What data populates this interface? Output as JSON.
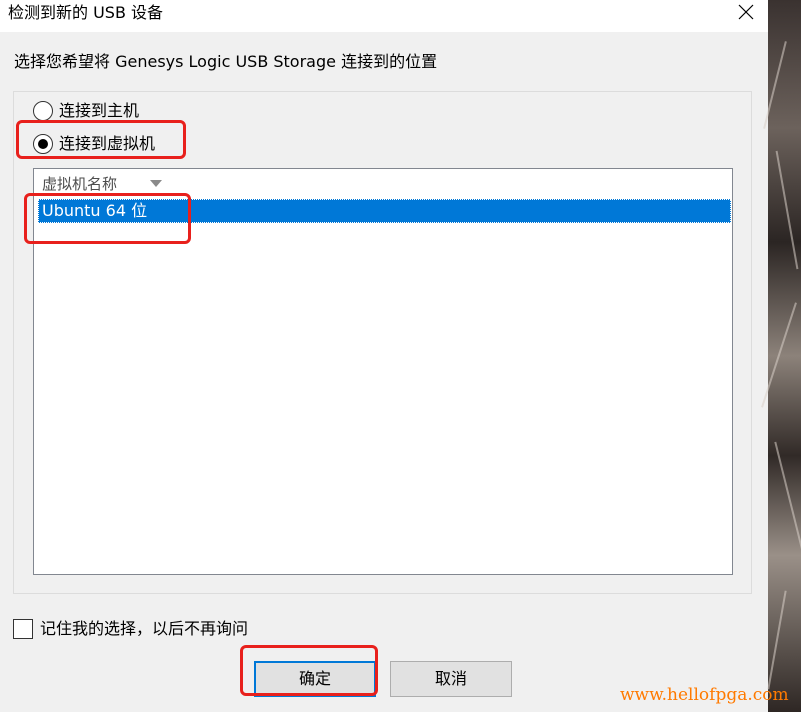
{
  "dialog": {
    "title": "检测到新的 USB 设备",
    "prompt": "选择您希望将 Genesys Logic USB Storage 连接到的位置",
    "options": [
      {
        "label": "连接到主机",
        "selected": false
      },
      {
        "label": "连接到虚拟机",
        "selected": true
      }
    ],
    "list": {
      "column_header": "虚拟机名称",
      "rows": [
        "Ubuntu 64 位"
      ],
      "selected_index": 0
    },
    "remember_label": "记住我的选择，以后不再询问",
    "remember_checked": false,
    "ok_label": "确定",
    "cancel_label": "取消"
  },
  "watermark": "www.hellofpga.com",
  "colors": {
    "highlight": "#e8201c",
    "selection": "#0078d7",
    "watermark": "#ff7a00"
  }
}
